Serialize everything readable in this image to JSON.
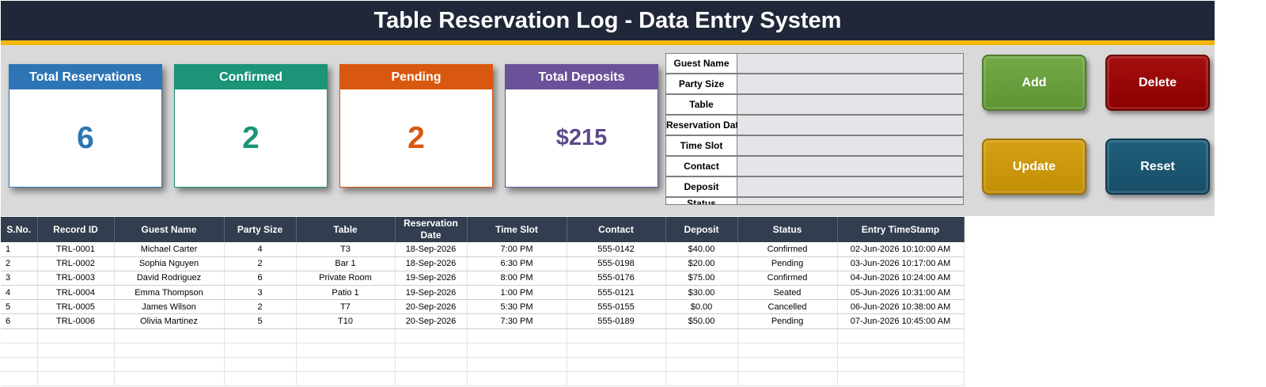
{
  "app": {
    "title": "Table Reservation Log - Data Entry System"
  },
  "colors": {
    "header": "#1f2738",
    "accent": "#f2b705",
    "blue": "#2e75b6",
    "teal": "#1b9478",
    "orange": "#d9580f",
    "purple": "#6a5199"
  },
  "kpis": {
    "total": {
      "label": "Total Reservations",
      "value": "6"
    },
    "confirmed": {
      "label": "Confirmed",
      "value": "2"
    },
    "pending": {
      "label": "Pending",
      "value": "2"
    },
    "deposits": {
      "label": "Total Deposits",
      "value": "$215"
    }
  },
  "form": {
    "fields": [
      {
        "label": "Guest Name",
        "value": ""
      },
      {
        "label": "Party Size",
        "value": ""
      },
      {
        "label": "Table",
        "value": ""
      },
      {
        "label": "Reservation Date",
        "value": ""
      },
      {
        "label": "Time Slot",
        "value": ""
      },
      {
        "label": "Contact",
        "value": ""
      },
      {
        "label": "Deposit",
        "value": ""
      },
      {
        "label": "Status",
        "value": ""
      }
    ]
  },
  "buttons": {
    "add": "Add",
    "delete": "Delete",
    "update": "Update",
    "reset": "Reset"
  },
  "table": {
    "headers": [
      "S.No.",
      "Record ID",
      "Guest Name",
      "Party Size",
      "Table",
      "Reservation Date",
      "Time Slot",
      "Contact",
      "Deposit",
      "Status",
      "Entry TimeStamp"
    ],
    "rows": [
      [
        "1",
        "TRL-0001",
        "Michael Carter",
        "4",
        "T3",
        "18-Sep-2026",
        "7:00 PM",
        "555-0142",
        "$40.00",
        "Confirmed",
        "02-Jun-2026 10:10:00 AM"
      ],
      [
        "2",
        "TRL-0002",
        "Sophia Nguyen",
        "2",
        "Bar 1",
        "18-Sep-2026",
        "6:30 PM",
        "555-0198",
        "$20.00",
        "Pending",
        "03-Jun-2026 10:17:00 AM"
      ],
      [
        "3",
        "TRL-0003",
        "David Rodriguez",
        "6",
        "Private Room",
        "19-Sep-2026",
        "8:00 PM",
        "555-0176",
        "$75.00",
        "Confirmed",
        "04-Jun-2026 10:24:00 AM"
      ],
      [
        "4",
        "TRL-0004",
        "Emma Thompson",
        "3",
        "Patio 1",
        "19-Sep-2026",
        "1:00 PM",
        "555-0121",
        "$30.00",
        "Seated",
        "05-Jun-2026 10:31:00 AM"
      ],
      [
        "5",
        "TRL-0005",
        "James Wilson",
        "2",
        "T7",
        "20-Sep-2026",
        "5:30 PM",
        "555-0155",
        "$0.00",
        "Cancelled",
        "06-Jun-2026 10:38:00 AM"
      ],
      [
        "6",
        "TRL-0006",
        "Olivia Martinez",
        "5",
        "T10",
        "20-Sep-2026",
        "7:30 PM",
        "555-0189",
        "$50.00",
        "Pending",
        "07-Jun-2026 10:45:00 AM"
      ]
    ]
  }
}
